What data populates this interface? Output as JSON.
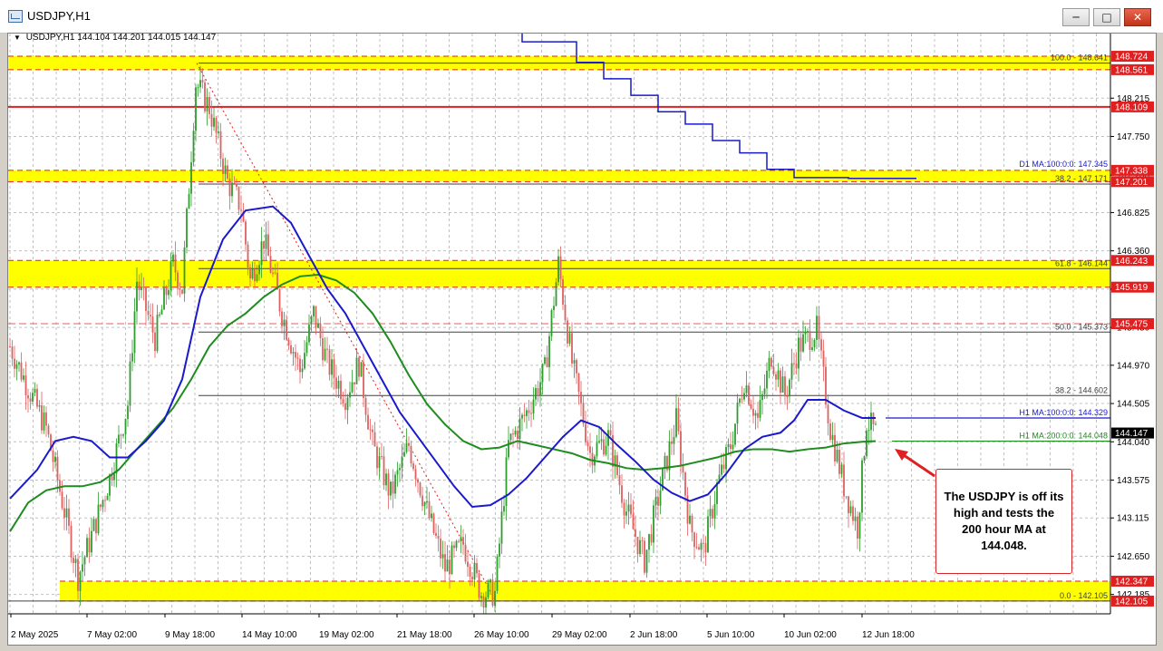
{
  "window": {
    "title": "USDJPY,H1",
    "buttons": {
      "minimize": "─",
      "restore": "□",
      "close": "✕"
    }
  },
  "header": {
    "symbol_tf": "USDJPY,H1",
    "ohlc": "144.104 144.201 144.015 144.147"
  },
  "colors": {
    "bull": "#2e9d2e",
    "bear": "#e06060",
    "ma100": "#1a1acc",
    "ma200": "#1e8c1e",
    "zone": "#ffff00",
    "price_badge": "#e02020"
  },
  "price_scale": {
    "labels": [
      "148.215",
      "147.750",
      "147.280",
      "146.825",
      "146.360",
      "145.895",
      "145.430",
      "144.970",
      "144.505",
      "144.040",
      "143.575",
      "143.115",
      "142.650",
      "142.185"
    ],
    "badges": [
      "148.724",
      "148.561",
      "148.109",
      "147.338",
      "147.201",
      "146.243",
      "145.919",
      "145.475",
      "142.347",
      "142.105"
    ],
    "current": "144.147"
  },
  "time_axis": [
    "2 May 2025",
    "7 May 02:00",
    "9 May 18:00",
    "14 May 10:00",
    "19 May 02:00",
    "21 May 18:00",
    "26 May 10:00",
    "29 May 02:00",
    "2 Jun 18:00",
    "5 Jun 10:00",
    "10 Jun 02:00",
    "12 Jun 18:00"
  ],
  "levels": [
    {
      "label": "100.0 - 148.641",
      "price": 148.641
    },
    {
      "label": "D1 MA:100:0:0: 147.345",
      "price": 147.345
    },
    {
      "label": "38.2 - 147.171",
      "price": 147.171
    },
    {
      "label": "61.8 - 146.144",
      "price": 146.144
    },
    {
      "label": "50.0 - 145.373",
      "price": 145.373
    },
    {
      "label": "38.2 - 144.602",
      "price": 144.602
    },
    {
      "label": "H1 MA:100:0:0: 144.329",
      "price": 144.329
    },
    {
      "label": "H1 MA:200:0:0: 144.048",
      "price": 144.048
    },
    {
      "label": "0.0 - 142.105",
      "price": 142.105
    }
  ],
  "zones": [
    {
      "high": 148.724,
      "low": 148.561
    },
    {
      "high": 147.338,
      "low": 147.201
    },
    {
      "high": 146.243,
      "low": 145.919
    },
    {
      "high": 142.347,
      "low": 142.105
    }
  ],
  "horizontal_lines": {
    "red": 148.109,
    "dashed": 145.475
  },
  "annotation": {
    "text": "The USDJPY is off its high and tests the 200 hour MA at 144.048."
  },
  "chart_data": {
    "type": "candlestick",
    "symbol": "USDJPY",
    "timeframe": "H1",
    "y_range": [
      141.95,
      149.0
    ],
    "close_path": [
      [
        0,
        145.2
      ],
      [
        4,
        144.2
      ],
      [
        6,
        143.2
      ],
      [
        7.5,
        142.4
      ],
      [
        9,
        142.9
      ],
      [
        11,
        143.6
      ],
      [
        13,
        144.5
      ],
      [
        14,
        146.0
      ],
      [
        16,
        145.3
      ],
      [
        18,
        146.2
      ],
      [
        19,
        145.9
      ],
      [
        20.5,
        148.4
      ],
      [
        22,
        148.1
      ],
      [
        24,
        147.2
      ],
      [
        25.5,
        146.9
      ],
      [
        26.5,
        146.0
      ],
      [
        28,
        146.5
      ],
      [
        30,
        145.6
      ],
      [
        32,
        144.9
      ],
      [
        33.5,
        145.6
      ],
      [
        35,
        145.0
      ],
      [
        37,
        144.6
      ],
      [
        38.5,
        145.0
      ],
      [
        40,
        144.0
      ],
      [
        42,
        143.4
      ],
      [
        44,
        144.0
      ],
      [
        46,
        143.2
      ],
      [
        48,
        142.5
      ],
      [
        50,
        142.8
      ],
      [
        52,
        142.2
      ],
      [
        53.5,
        142.2
      ],
      [
        55,
        144.0
      ],
      [
        57,
        144.4
      ],
      [
        59,
        144.9
      ],
      [
        60.5,
        146.2
      ],
      [
        62,
        145.0
      ],
      [
        64,
        143.9
      ],
      [
        66,
        144.1
      ],
      [
        68,
        143.2
      ],
      [
        70,
        142.6
      ],
      [
        72,
        143.6
      ],
      [
        73.5,
        144.3
      ],
      [
        75,
        143.0
      ],
      [
        76.5,
        142.7
      ],
      [
        78,
        143.5
      ],
      [
        79.5,
        144.0
      ],
      [
        81,
        144.8
      ],
      [
        82.5,
        144.3
      ],
      [
        84,
        145.1
      ],
      [
        85.5,
        144.6
      ],
      [
        87,
        145.2
      ],
      [
        89,
        145.4
      ],
      [
        90.5,
        144.2
      ],
      [
        92,
        143.5
      ],
      [
        93.5,
        143.0
      ],
      [
        94.5,
        144.3
      ],
      [
        95.5,
        144.147
      ]
    ],
    "ma_d1_100_steps": [
      [
        55.5,
        149.4
      ],
      [
        56.5,
        148.9
      ],
      [
        58,
        148.9
      ],
      [
        62.5,
        148.65
      ],
      [
        65.5,
        148.45
      ],
      [
        68.5,
        148.25
      ],
      [
        71.5,
        148.05
      ],
      [
        74.5,
        147.9
      ],
      [
        77.5,
        147.7
      ],
      [
        80.5,
        147.55
      ],
      [
        83.5,
        147.35
      ],
      [
        86.5,
        147.25
      ],
      [
        92.5,
        147.24
      ],
      [
        100,
        147.24
      ]
    ],
    "ma_h1_100": [
      [
        0,
        143.35
      ],
      [
        3,
        143.7
      ],
      [
        5,
        144.05
      ],
      [
        7,
        144.1
      ],
      [
        9,
        144.05
      ],
      [
        11,
        143.85
      ],
      [
        13,
        143.85
      ],
      [
        15,
        144.05
      ],
      [
        17,
        144.3
      ],
      [
        19,
        144.8
      ],
      [
        21,
        145.8
      ],
      [
        23.5,
        146.5
      ],
      [
        26,
        146.85
      ],
      [
        29,
        146.9
      ],
      [
        31,
        146.7
      ],
      [
        33,
        146.3
      ],
      [
        35,
        145.9
      ],
      [
        37,
        145.6
      ],
      [
        39,
        145.2
      ],
      [
        41,
        144.8
      ],
      [
        43,
        144.4
      ],
      [
        45,
        144.1
      ],
      [
        47,
        143.8
      ],
      [
        49,
        143.5
      ],
      [
        51,
        143.25
      ],
      [
        53,
        143.27
      ],
      [
        55,
        143.4
      ],
      [
        57,
        143.6
      ],
      [
        59,
        143.85
      ],
      [
        61,
        144.1
      ],
      [
        63,
        144.3
      ],
      [
        65,
        144.22
      ],
      [
        67,
        144.0
      ],
      [
        69,
        143.8
      ],
      [
        71,
        143.58
      ],
      [
        73,
        143.42
      ],
      [
        75,
        143.32
      ],
      [
        77,
        143.4
      ],
      [
        79,
        143.65
      ],
      [
        81,
        143.95
      ],
      [
        83,
        144.1
      ],
      [
        85,
        144.15
      ],
      [
        86.5,
        144.3
      ],
      [
        88,
        144.55
      ],
      [
        90,
        144.55
      ],
      [
        92,
        144.42
      ],
      [
        94,
        144.33
      ],
      [
        95.5,
        144.33
      ]
    ],
    "ma_h1_200": [
      [
        0,
        142.95
      ],
      [
        2,
        143.3
      ],
      [
        4,
        143.45
      ],
      [
        6,
        143.5
      ],
      [
        8,
        143.5
      ],
      [
        10,
        143.55
      ],
      [
        12,
        143.7
      ],
      [
        14,
        143.95
      ],
      [
        16,
        144.2
      ],
      [
        18,
        144.45
      ],
      [
        20,
        144.8
      ],
      [
        22,
        145.2
      ],
      [
        24,
        145.45
      ],
      [
        26,
        145.6
      ],
      [
        28,
        145.8
      ],
      [
        30,
        145.95
      ],
      [
        32,
        146.05
      ],
      [
        34,
        146.07
      ],
      [
        36,
        146.0
      ],
      [
        38,
        145.85
      ],
      [
        40,
        145.6
      ],
      [
        42,
        145.25
      ],
      [
        44,
        144.85
      ],
      [
        46,
        144.5
      ],
      [
        48,
        144.25
      ],
      [
        50,
        144.05
      ],
      [
        52,
        143.95
      ],
      [
        54,
        143.97
      ],
      [
        56,
        144.05
      ],
      [
        58,
        144.0
      ],
      [
        60,
        143.95
      ],
      [
        62,
        143.9
      ],
      [
        64,
        143.82
      ],
      [
        66,
        143.78
      ],
      [
        68,
        143.72
      ],
      [
        70,
        143.7
      ],
      [
        72,
        143.72
      ],
      [
        74,
        143.75
      ],
      [
        76,
        143.8
      ],
      [
        78,
        143.85
      ],
      [
        80,
        143.92
      ],
      [
        82,
        143.95
      ],
      [
        84,
        143.95
      ],
      [
        86,
        143.92
      ],
      [
        88,
        143.95
      ],
      [
        90,
        143.97
      ],
      [
        92,
        144.02
      ],
      [
        94,
        144.04
      ],
      [
        95.5,
        144.048
      ]
    ]
  }
}
